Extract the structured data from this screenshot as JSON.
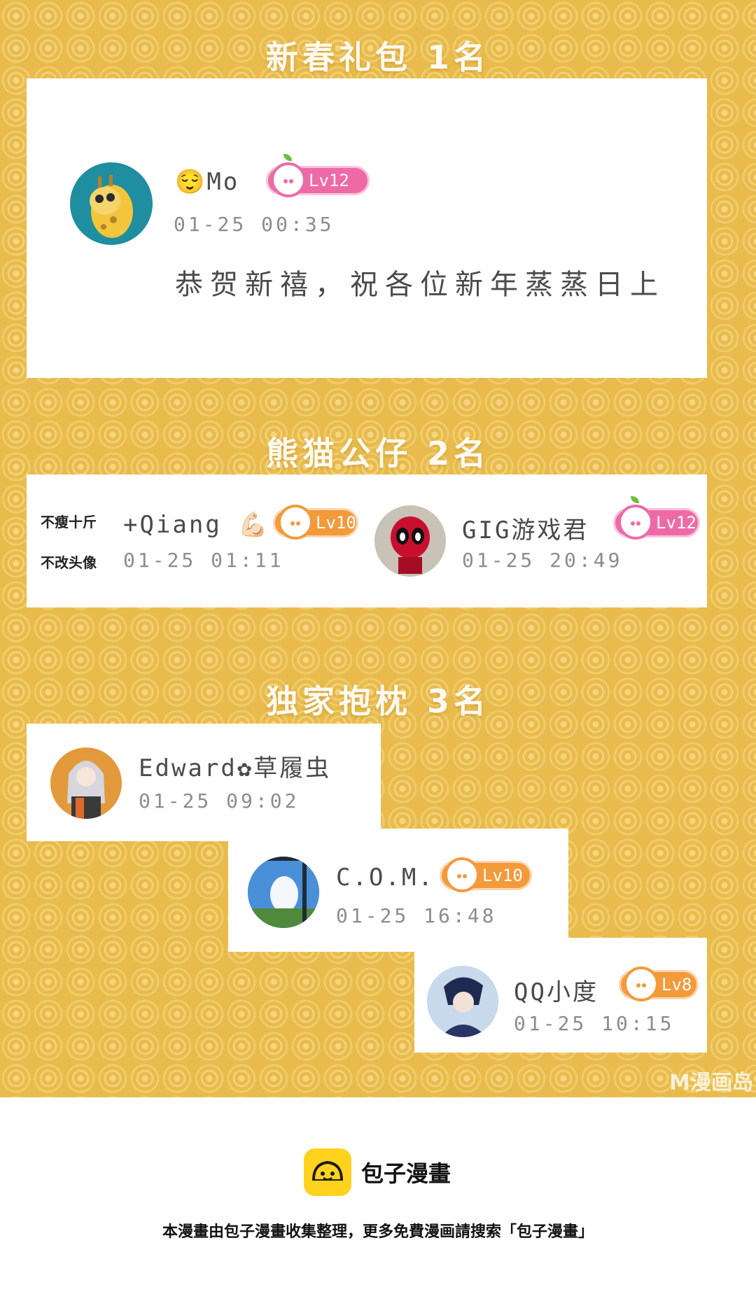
{
  "sections": {
    "first": {
      "title": "新春礼包 1名"
    },
    "second": {
      "title": "熊猫公仔 2名"
    },
    "third": {
      "title": "独家抱枕 3名"
    }
  },
  "winners": {
    "mo": {
      "name": "😌Mo",
      "level": "Lv12",
      "time": "01-25 00:35",
      "comment": "恭贺新禧，祝各位新年蒸蒸日上"
    },
    "qiang": {
      "side_note_1": "不瘦十斤",
      "side_note_2": "不改头像",
      "name": "+Qiang 💪🏻",
      "level": "Lv10",
      "time": "01-25 01:11"
    },
    "gig": {
      "name": "GIG游戏君",
      "level": "Lv12",
      "time": "01-25 20:49"
    },
    "edward": {
      "name": "Edward✿草履虫",
      "time": "01-25 09:02"
    },
    "com": {
      "name": "C.O.M.",
      "level": "Lv10",
      "time": "01-25 16:48"
    },
    "qq": {
      "name": "QQ小度",
      "level": "Lv8",
      "time": "01-25 10:15"
    }
  },
  "watermark": "M漫画岛",
  "footer": {
    "brand": "包子漫畫",
    "note": "本漫畫由包子漫畫收集整理，更多免費漫画請搜索「包子漫畫」"
  },
  "colors": {
    "background": "#e8bb4c",
    "level_pink": "#ee6aa7",
    "level_orange": "#f39a3b",
    "logo_yellow": "#ffd21e"
  },
  "icons": [
    "giraffe-avatar",
    "deadpool-avatar",
    "anime-girl-avatar",
    "sky-window-avatar",
    "anime-boy-avatar",
    "bun-logo-icon"
  ]
}
